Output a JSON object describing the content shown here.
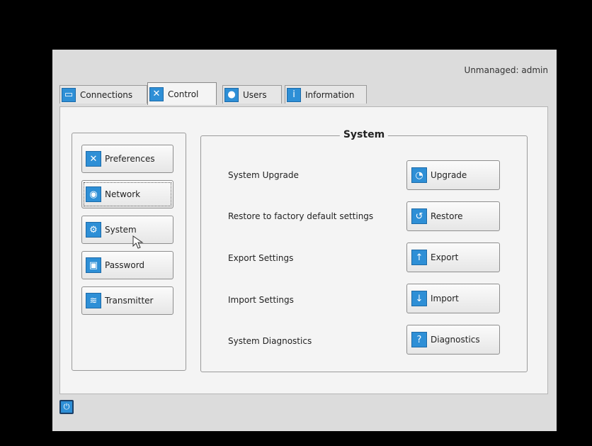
{
  "status": {
    "text": "Unmanaged:  admin"
  },
  "tabs": [
    {
      "label": "Connections",
      "icon": "monitor-icon",
      "active": false
    },
    {
      "label": "Control",
      "icon": "tools-icon",
      "active": true
    },
    {
      "label": "Users",
      "icon": "users-icon",
      "active": false
    },
    {
      "label": "Information",
      "icon": "info-icon",
      "active": false
    }
  ],
  "sidebar": {
    "items": [
      {
        "label": "Preferences",
        "icon": "tools-icon"
      },
      {
        "label": "Network",
        "icon": "network-icon"
      },
      {
        "label": "System",
        "icon": "gear-icon"
      },
      {
        "label": "Password",
        "icon": "lock-icon"
      },
      {
        "label": "Transmitter",
        "icon": "transmitter-icon"
      }
    ]
  },
  "system": {
    "title": "System",
    "rows": [
      {
        "label": "System Upgrade",
        "button": "Upgrade",
        "icon": "upgrade-icon"
      },
      {
        "label": "Restore to factory default settings",
        "button": "Restore",
        "icon": "restore-icon"
      },
      {
        "label": "Export Settings",
        "button": "Export",
        "icon": "export-arrow-icon"
      },
      {
        "label": "Import Settings",
        "button": "Import",
        "icon": "import-arrow-icon"
      },
      {
        "label": "System Diagnostics",
        "button": "Diagnostics",
        "icon": "help-icon"
      }
    ]
  },
  "colors": {
    "accent": "#2e8fd6",
    "background": "#dcdcdc",
    "panel": "#f4f4f4"
  }
}
